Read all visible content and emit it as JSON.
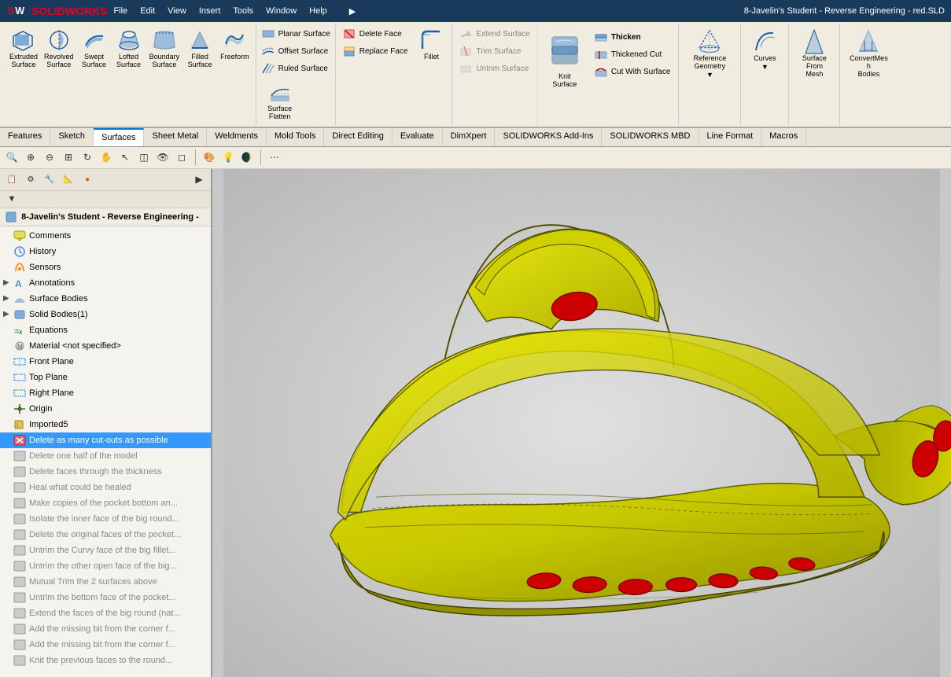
{
  "app": {
    "logo": "SOLIDWORKS",
    "title": "8-Javelin's Student - Reverse Engineering - red.SLD"
  },
  "menu": {
    "items": [
      "File",
      "Edit",
      "View",
      "Insert",
      "Tools",
      "Window",
      "Help"
    ]
  },
  "toolbar": {
    "surfaces_group": [
      {
        "label": "Extruded\nSurface",
        "name": "extruded-surface"
      },
      {
        "label": "Revolved\nSurface",
        "name": "revolved-surface"
      },
      {
        "label": "Swept\nSurface",
        "name": "swept-surface"
      },
      {
        "label": "Lofted\nSurface",
        "name": "lofted-surface"
      },
      {
        "label": "Boundary\nSurface",
        "name": "boundary-surface"
      },
      {
        "label": "Filled\nSurface",
        "name": "filled-surface"
      },
      {
        "label": "Freeform",
        "name": "freeform"
      }
    ],
    "planar_group": [
      {
        "label": "Planar Surface",
        "name": "planar-surface"
      },
      {
        "label": "Offset Surface",
        "name": "offset-surface"
      },
      {
        "label": "Ruled Surface",
        "name": "ruled-surface"
      }
    ],
    "surface_flatten_group": [
      {
        "label": "Surface\nFlatten",
        "name": "surface-flatten"
      }
    ],
    "delete_replace_group": [
      {
        "label": "Delete Face",
        "name": "delete-face"
      },
      {
        "label": "Replace Face",
        "name": "replace-face"
      }
    ],
    "extend_trim_group": [
      {
        "label": "Extend Surface",
        "name": "extend-surface"
      },
      {
        "label": "Trim Surface",
        "name": "trim-surface"
      },
      {
        "label": "Untrim Surface",
        "name": "untrim-surface"
      }
    ],
    "fillet": {
      "label": "Fillet",
      "name": "fillet"
    },
    "knit": {
      "label": "Knit\nSurface",
      "name": "knit-surface"
    },
    "thicken": {
      "label": "Thicken",
      "name": "thicken"
    },
    "thickened_cut": {
      "label": "Thickened Cut",
      "name": "thickened-cut"
    },
    "cut_with_surface": {
      "label": "Cut With Surface",
      "name": "cut-with-surface"
    },
    "reference_geometry": {
      "label": "Reference\nGeometry",
      "name": "reference-geometry"
    },
    "curves": {
      "label": "Curves",
      "name": "curves"
    },
    "surface_from_mesh": {
      "label": "Surface\nFrom\nMesh",
      "name": "surface-from-mesh"
    },
    "convert_mesh_bodies": {
      "label": "ConvertMesh\nBodies",
      "name": "convert-mesh-bodies"
    }
  },
  "tabs": {
    "items": [
      "Features",
      "Sketch",
      "Surfaces",
      "Sheet Metal",
      "Weldments",
      "Mold Tools",
      "Direct Editing",
      "Evaluate",
      "DimXpert",
      "SOLIDWORKS Add-Ins",
      "SOLIDWORKS MBD",
      "Line Format",
      "Macros"
    ],
    "active": "Surfaces"
  },
  "panel": {
    "document_title": "8-Javelin's Student - Reverse Engineering -",
    "tree_items": [
      {
        "label": "Comments",
        "icon": "comment",
        "indent": 1,
        "expandable": false
      },
      {
        "label": "History",
        "icon": "history",
        "indent": 1,
        "expandable": false
      },
      {
        "label": "Sensors",
        "icon": "sensor",
        "indent": 1,
        "expandable": false
      },
      {
        "label": "Annotations",
        "icon": "annotation",
        "indent": 1,
        "expandable": true
      },
      {
        "label": "Surface Bodies",
        "icon": "surface",
        "indent": 1,
        "expandable": true
      },
      {
        "label": "Solid Bodies(1)",
        "icon": "solid",
        "indent": 1,
        "expandable": true
      },
      {
        "label": "Equations",
        "icon": "equation",
        "indent": 1,
        "expandable": false
      },
      {
        "label": "Material <not specified>",
        "icon": "material",
        "indent": 1,
        "expandable": false
      },
      {
        "label": "Front Plane",
        "icon": "plane",
        "indent": 1,
        "expandable": false
      },
      {
        "label": "Top Plane",
        "icon": "plane",
        "indent": 1,
        "expandable": false
      },
      {
        "label": "Right Plane",
        "icon": "plane",
        "indent": 1,
        "expandable": false
      },
      {
        "label": "Origin",
        "icon": "origin",
        "indent": 1,
        "expandable": false
      },
      {
        "label": "Imported5",
        "icon": "import",
        "indent": 1,
        "expandable": false
      },
      {
        "label": "Delete as many cut-outs as possible",
        "icon": "feature",
        "indent": 1,
        "expandable": false,
        "selected": true
      },
      {
        "label": "Delete one half of the model",
        "icon": "feature",
        "indent": 1,
        "expandable": false,
        "grayed": true
      },
      {
        "label": "Delete faces through the thickness",
        "icon": "feature",
        "indent": 1,
        "expandable": false,
        "grayed": true
      },
      {
        "label": "Heal what could be healed",
        "icon": "feature",
        "indent": 1,
        "expandable": false,
        "grayed": true
      },
      {
        "label": "Make copies of the pocket bottom an...",
        "icon": "feature",
        "indent": 1,
        "expandable": false,
        "grayed": true
      },
      {
        "label": "Isolate the inner face of the big round...",
        "icon": "feature",
        "indent": 1,
        "expandable": false,
        "grayed": true
      },
      {
        "label": "Delete the original faces of the pocket...",
        "icon": "feature",
        "indent": 1,
        "expandable": false,
        "grayed": true
      },
      {
        "label": "Untrim the Curvy face of the big fillet...",
        "icon": "feature",
        "indent": 1,
        "expandable": false,
        "grayed": true
      },
      {
        "label": "Untrim the other open face of the big...",
        "icon": "feature",
        "indent": 1,
        "expandable": false,
        "grayed": true
      },
      {
        "label": "Mutual Trim the 2 surfaces above",
        "icon": "feature",
        "indent": 1,
        "expandable": false,
        "grayed": true
      },
      {
        "label": "Untrim the bottom face of the pocket...",
        "icon": "feature",
        "indent": 1,
        "expandable": false,
        "grayed": true
      },
      {
        "label": "Extend the faces of the big round (nat...",
        "icon": "feature",
        "indent": 1,
        "expandable": false,
        "grayed": true
      },
      {
        "label": "Add the missing bit from the corner f...",
        "icon": "feature",
        "indent": 1,
        "expandable": false,
        "grayed": true
      },
      {
        "label": "Add the missing bit from the corner f...",
        "icon": "feature",
        "indent": 1,
        "expandable": false,
        "grayed": true
      },
      {
        "label": "Knit the previous faces to the round...",
        "icon": "feature",
        "indent": 1,
        "expandable": false,
        "grayed": true
      }
    ]
  },
  "viewport": {
    "model_description": "Yellow 3D CAD model of a curved surface part (Javelin student reverse engineering)"
  }
}
